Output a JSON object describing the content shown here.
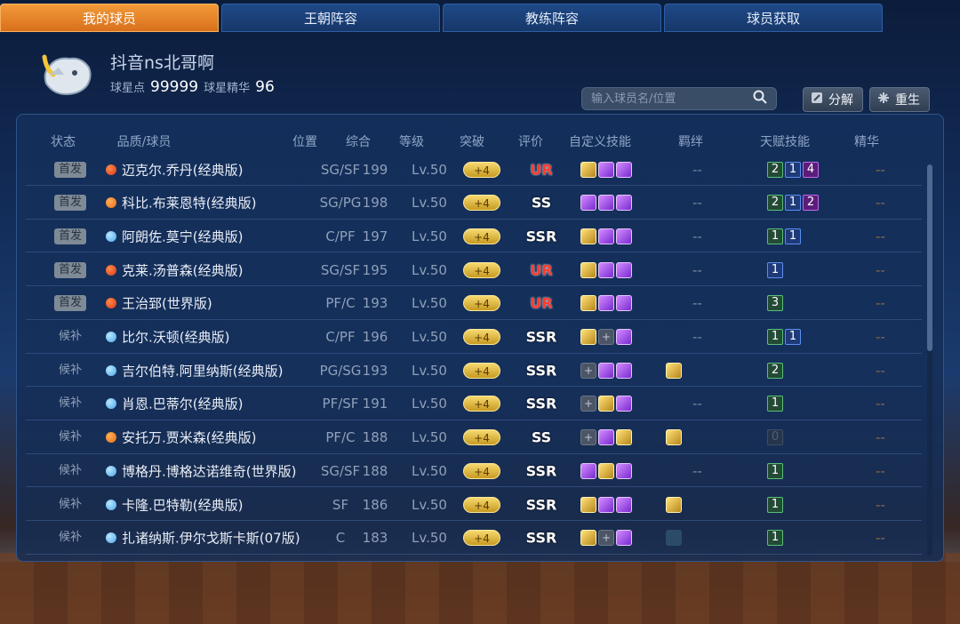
{
  "tabs": [
    "我的球员",
    "王朝阵容",
    "教练阵容",
    "球员获取"
  ],
  "active_tab": 0,
  "profile": {
    "name": "抖音ns北哥啊",
    "points_label": "球星点",
    "points_value": "99999",
    "essence_label": "球星精华",
    "essence_value": "96"
  },
  "search": {
    "placeholder": "输入球员名/位置"
  },
  "buttons": {
    "decompose": "分解",
    "rebirth": "重生"
  },
  "columns": [
    "状态",
    "品质/球员",
    "位置",
    "综合",
    "等级",
    "突破",
    "评价",
    "自定义技能",
    "羁绊",
    "天赋技能",
    "精华"
  ],
  "players": [
    {
      "status": "首发",
      "starter": true,
      "quality": "red",
      "name": "迈克尔.乔丹(经典版)",
      "pos": "SG/SF",
      "ovr": "199",
      "level": "Lv.50",
      "break": "+4",
      "grade": "UR",
      "skills": [
        "gold",
        "purple",
        "purple"
      ],
      "bond": "--",
      "talents": [
        {
          "v": "2",
          "c": "green"
        },
        {
          "v": "1",
          "c": "blue"
        },
        {
          "v": "4",
          "c": "purple"
        }
      ],
      "essence": "--"
    },
    {
      "status": "首发",
      "starter": true,
      "quality": "orange",
      "name": "科比.布莱恩特(经典版)",
      "pos": "SG/PG",
      "ovr": "198",
      "level": "Lv.50",
      "break": "+4",
      "grade": "SS",
      "skills": [
        "purple",
        "purple",
        "purple"
      ],
      "bond": "--",
      "talents": [
        {
          "v": "2",
          "c": "green"
        },
        {
          "v": "1",
          "c": "blue"
        },
        {
          "v": "2",
          "c": "purple"
        }
      ],
      "essence": "--"
    },
    {
      "status": "首发",
      "starter": true,
      "quality": "blue",
      "name": "阿朗佐.莫宁(经典版)",
      "pos": "C/PF",
      "ovr": "197",
      "level": "Lv.50",
      "break": "+4",
      "grade": "SSR",
      "skills": [
        "gold",
        "purple",
        "purple"
      ],
      "bond": "--",
      "talents": [
        {
          "v": "1",
          "c": "green"
        },
        {
          "v": "1",
          "c": "blue"
        }
      ],
      "essence": "--"
    },
    {
      "status": "首发",
      "starter": true,
      "quality": "red",
      "name": "克莱.汤普森(经典版)",
      "pos": "SG/SF",
      "ovr": "195",
      "level": "Lv.50",
      "break": "+4",
      "grade": "UR",
      "skills": [
        "gold",
        "purple",
        "purple"
      ],
      "bond": "--",
      "talents": [
        {
          "v": "1",
          "c": "blue"
        }
      ],
      "essence": "--"
    },
    {
      "status": "首发",
      "starter": true,
      "quality": "red",
      "name": "王治郅(世界版)",
      "pos": "PF/C",
      "ovr": "193",
      "level": "Lv.50",
      "break": "+4",
      "grade": "UR",
      "skills": [
        "gold",
        "purple",
        "purple"
      ],
      "bond": "--",
      "talents": [
        {
          "v": "3",
          "c": "green"
        }
      ],
      "essence": "--"
    },
    {
      "status": "候补",
      "starter": false,
      "quality": "blue",
      "name": "比尔.沃顿(经典版)",
      "pos": "C/PF",
      "ovr": "196",
      "level": "Lv.50",
      "break": "+4",
      "grade": "SSR",
      "skills": [
        "gold",
        "empty",
        "purple"
      ],
      "bond": "--",
      "talents": [
        {
          "v": "1",
          "c": "green"
        },
        {
          "v": "1",
          "c": "blue"
        }
      ],
      "essence": "--"
    },
    {
      "status": "候补",
      "starter": false,
      "quality": "blue",
      "name": "吉尔伯特.阿里纳斯(经典版)",
      "pos": "PG/SG",
      "ovr": "193",
      "level": "Lv.50",
      "break": "+4",
      "grade": "SSR",
      "skills": [
        "empty",
        "purple",
        "purple"
      ],
      "bond": "gold",
      "talents": [
        {
          "v": "2",
          "c": "green"
        }
      ],
      "essence": "--"
    },
    {
      "status": "候补",
      "starter": false,
      "quality": "blue",
      "name": "肖恩.巴蒂尔(经典版)",
      "pos": "PF/SF",
      "ovr": "191",
      "level": "Lv.50",
      "break": "+4",
      "grade": "SSR",
      "skills": [
        "empty",
        "gold",
        "purple"
      ],
      "bond": "--",
      "talents": [
        {
          "v": "1",
          "c": "green"
        }
      ],
      "essence": "--"
    },
    {
      "status": "候补",
      "starter": false,
      "quality": "orange",
      "name": "安托万.贾米森(经典版)",
      "pos": "PF/C",
      "ovr": "188",
      "level": "Lv.50",
      "break": "+4",
      "grade": "SS",
      "skills": [
        "empty",
        "purple",
        "gold"
      ],
      "bond": "gold",
      "talents": [
        {
          "v": "0",
          "c": "gray"
        }
      ],
      "essence": "--"
    },
    {
      "status": "候补",
      "starter": false,
      "quality": "blue",
      "name": "博格丹.博格达诺维奇(世界版)",
      "pos": "SG/SF",
      "ovr": "188",
      "level": "Lv.50",
      "break": "+4",
      "grade": "SSR",
      "skills": [
        "purple",
        "gold",
        "purple"
      ],
      "bond": "--",
      "talents": [
        {
          "v": "1",
          "c": "green"
        }
      ],
      "essence": "--"
    },
    {
      "status": "候补",
      "starter": false,
      "quality": "blue",
      "name": "卡隆.巴特勒(经典版)",
      "pos": "SF",
      "ovr": "186",
      "level": "Lv.50",
      "break": "+4",
      "grade": "SSR",
      "skills": [
        "gold",
        "purple",
        "purple"
      ],
      "bond": "gold",
      "talents": [
        {
          "v": "1",
          "c": "green"
        }
      ],
      "essence": "--"
    },
    {
      "status": "候补",
      "starter": false,
      "quality": "blue",
      "name": "扎诸纳斯.伊尔戈斯卡斯(07版)",
      "pos": "C",
      "ovr": "183",
      "level": "Lv.50",
      "break": "+4",
      "grade": "SSR",
      "skills": [
        "gold",
        "empty",
        "purple"
      ],
      "bond": "dim",
      "talents": [
        {
          "v": "1",
          "c": "green"
        }
      ],
      "essence": "--"
    }
  ]
}
